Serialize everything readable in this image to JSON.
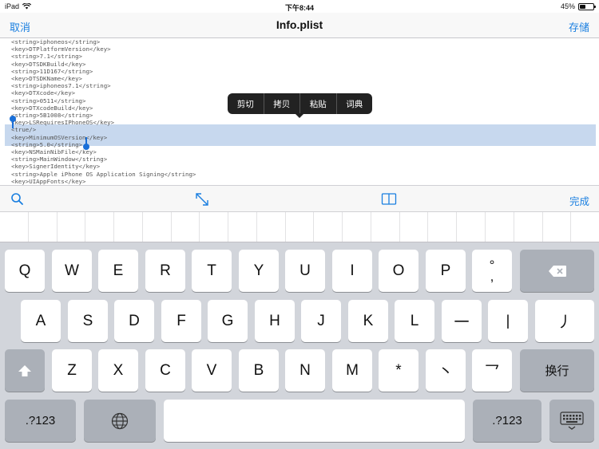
{
  "status": {
    "device": "iPad",
    "time": "下午8:44",
    "battery": "45%",
    "battery_fraction": 0.45
  },
  "nav": {
    "cancel": "取消",
    "title": "Info.plist",
    "save": "存储"
  },
  "editor": {
    "lines": [
      "<string>iphoneos</string>",
      "<key>DTPlatformVersion</key>",
      "<string>7.1</string>",
      "<key>DTSDKBuild</key>",
      "<string>11D167</string>",
      "<key>DTSDKName</key>",
      "<string>iphoneos7.1</string>",
      "<key>DTXcode</key>",
      "<string>0511</string>",
      "<key>DTXcodeBuild</key>",
      "<string>5B1008</string>",
      "<key>LSRequiresIPhoneOS</key>",
      "<true/>",
      "<key>MinimumOSVersion</key>",
      "<string>5.0</string>",
      "<key>NSMainNibFile</key>",
      "<string>MainWindow</string>",
      "<key>SignerIdentity</key>",
      "<string>Apple iPhone OS Application Signing</string>",
      "<key>UIAppFonts</key>"
    ]
  },
  "context_menu": {
    "cut": "剪切",
    "copy": "拷贝",
    "paste": "粘贴",
    "define": "词典"
  },
  "toolbar": {
    "search_icon": "magnifier-icon",
    "resize_icon": "expand-arrows-icon",
    "book_icon": "open-book-icon",
    "done": "完成",
    "accent": "#1a7fe0"
  },
  "keyboard": {
    "row1": [
      "Q",
      "W",
      "E",
      "R",
      "T",
      "Y",
      "U",
      "I",
      "O",
      "P",
      "°,"
    ],
    "row2": [
      "A",
      "S",
      "D",
      "F",
      "G",
      "H",
      "J",
      "K",
      "L",
      "一",
      "丨",
      "丿"
    ],
    "row3": [
      "Z",
      "X",
      "C",
      "V",
      "B",
      "N",
      "M",
      "*",
      "丶",
      "乛"
    ],
    "return": "换行",
    "numbers": ".?123"
  }
}
